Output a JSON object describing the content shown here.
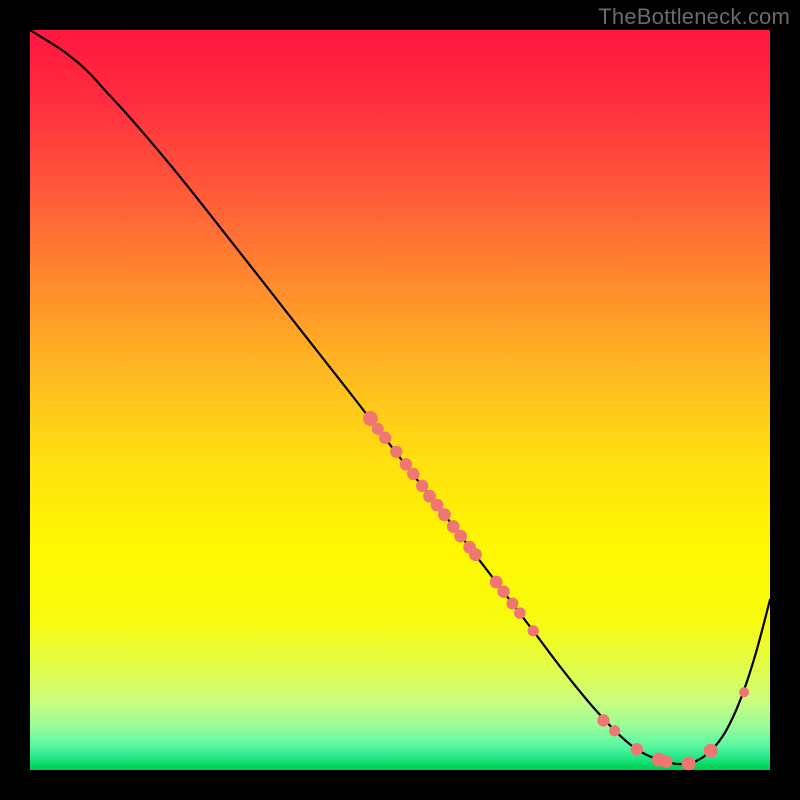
{
  "watermark": "TheBottleneck.com",
  "chart_data": {
    "type": "line",
    "title": "",
    "xlabel": "",
    "ylabel": "",
    "xlim": [
      0,
      100
    ],
    "ylim": [
      0,
      100
    ],
    "series": [
      {
        "name": "bottleneck-curve",
        "x": [
          0,
          4,
          6,
          8,
          10,
          14,
          20,
          28,
          36,
          44,
          50,
          56,
          62,
          68,
          72,
          76,
          80,
          83,
          86,
          88,
          90,
          92,
          94,
          96,
          98,
          100
        ],
        "y": [
          100,
          97.5,
          96,
          94.2,
          92,
          87.6,
          80.5,
          70.4,
          60.2,
          50.0,
          42.2,
          34.5,
          26.7,
          18.8,
          13.5,
          8.6,
          4.4,
          2.2,
          1.1,
          0.8,
          1.2,
          2.6,
          5.2,
          9.5,
          15.5,
          23.0
        ]
      }
    ],
    "scatter": {
      "name": "data-points",
      "points": [
        {
          "x": 46.0,
          "y": 47.5,
          "r": 7.5
        },
        {
          "x": 47.0,
          "y": 46.1,
          "r": 6.0
        },
        {
          "x": 48.0,
          "y": 44.9,
          "r": 6.2
        },
        {
          "x": 49.5,
          "y": 43.0,
          "r": 6.2
        },
        {
          "x": 50.8,
          "y": 41.3,
          "r": 6.2
        },
        {
          "x": 51.8,
          "y": 40.0,
          "r": 6.2
        },
        {
          "x": 53.0,
          "y": 38.4,
          "r": 6.2
        },
        {
          "x": 54.0,
          "y": 37.0,
          "r": 6.4
        },
        {
          "x": 55.0,
          "y": 35.8,
          "r": 6.4
        },
        {
          "x": 56.0,
          "y": 34.5,
          "r": 6.4
        },
        {
          "x": 57.2,
          "y": 32.9,
          "r": 6.4
        },
        {
          "x": 58.2,
          "y": 31.6,
          "r": 6.4
        },
        {
          "x": 59.4,
          "y": 30.1,
          "r": 6.4
        },
        {
          "x": 60.2,
          "y": 29.1,
          "r": 6.4
        },
        {
          "x": 63.0,
          "y": 25.4,
          "r": 6.4
        },
        {
          "x": 64.0,
          "y": 24.1,
          "r": 6.2
        },
        {
          "x": 65.2,
          "y": 22.5,
          "r": 6.0
        },
        {
          "x": 66.2,
          "y": 21.2,
          "r": 5.8
        },
        {
          "x": 68.0,
          "y": 18.8,
          "r": 5.6
        },
        {
          "x": 77.5,
          "y": 6.7,
          "r": 6.2
        },
        {
          "x": 79.0,
          "y": 5.3,
          "r": 5.6
        },
        {
          "x": 82.0,
          "y": 2.8,
          "r": 6.2
        },
        {
          "x": 85.0,
          "y": 1.4,
          "r": 7.0
        },
        {
          "x": 86.0,
          "y": 1.1,
          "r": 6.2
        },
        {
          "x": 89.0,
          "y": 0.9,
          "r": 7.0
        },
        {
          "x": 92.0,
          "y": 2.6,
          "r": 7.0
        },
        {
          "x": 96.5,
          "y": 10.5,
          "r": 5.0
        }
      ]
    }
  }
}
